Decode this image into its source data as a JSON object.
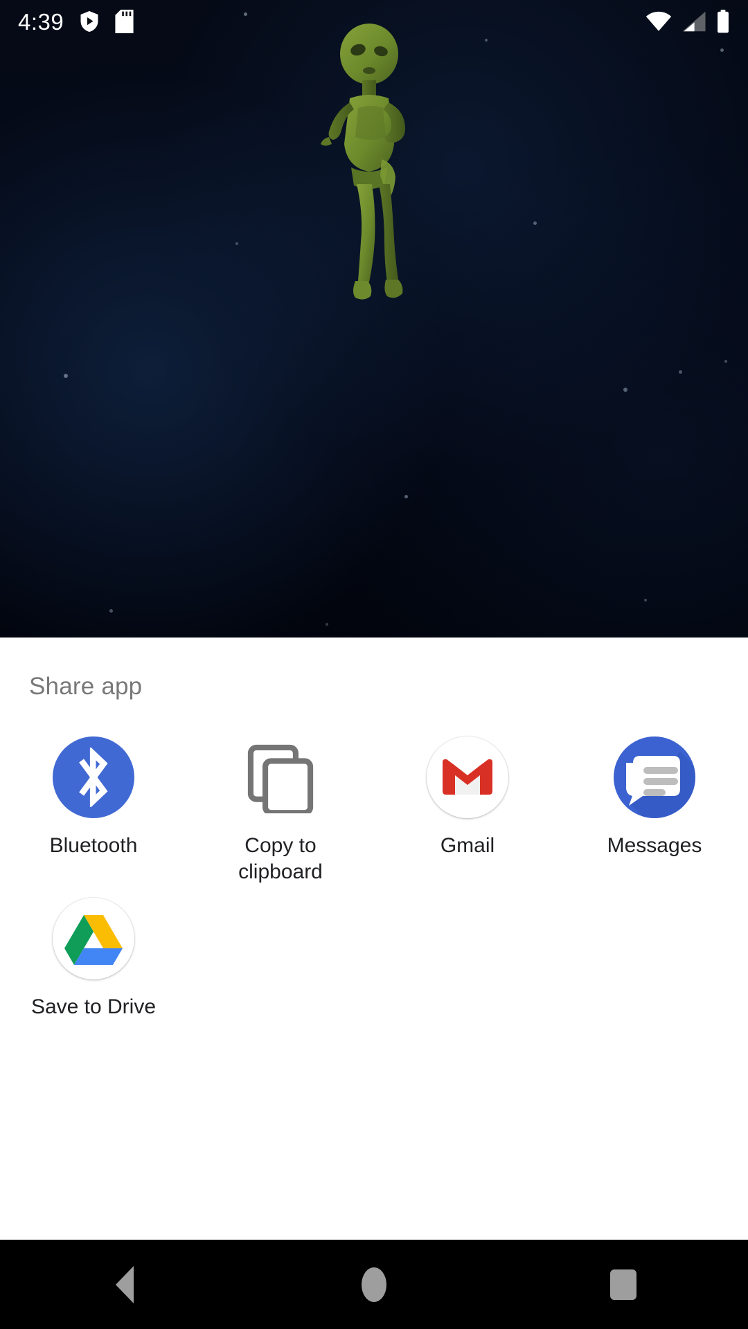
{
  "status_bar": {
    "time": "4:39",
    "icons": [
      {
        "name": "play-protect-shield-icon"
      },
      {
        "name": "sd-card-icon"
      },
      {
        "name": "wifi-icon"
      },
      {
        "name": "cellular-signal-icon"
      },
      {
        "name": "battery-full-icon"
      }
    ]
  },
  "wallpaper": {
    "description": "dark space background with alien creature",
    "background_color": "#040a18",
    "alien_color": "#6f8f2e"
  },
  "share_sheet": {
    "title": "Share app",
    "title_color": "#787878",
    "background_color": "#ffffff",
    "targets": [
      {
        "label": "Bluetooth",
        "icon": "bluetooth-icon",
        "color": "#4169d4"
      },
      {
        "label": "Copy to clipboard",
        "icon": "copy-to-clipboard-icon",
        "color": "#757575"
      },
      {
        "label": "Gmail",
        "icon": "gmail-icon",
        "color": "#d93025"
      },
      {
        "label": "Messages",
        "icon": "messages-icon",
        "color": "#3b62d0"
      },
      {
        "label": "Save to Drive",
        "icon": "google-drive-icon",
        "color": "#0f9d58"
      }
    ]
  },
  "navigation_bar": {
    "background_color": "#000000",
    "buttons": [
      {
        "name": "back-button",
        "icon": "back-triangle-icon"
      },
      {
        "name": "home-button",
        "icon": "home-circle-icon"
      },
      {
        "name": "recents-button",
        "icon": "recents-square-icon"
      }
    ]
  }
}
